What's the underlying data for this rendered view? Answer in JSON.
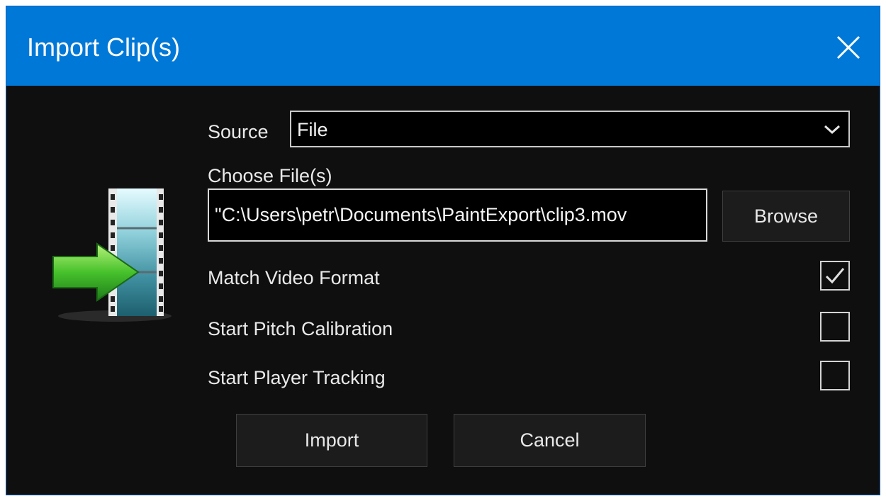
{
  "window": {
    "title": "Import Clip(s)",
    "close_icon": "close-icon"
  },
  "form": {
    "source_label": "Source",
    "source_value": "File",
    "choose_files_label": "Choose File(s)",
    "file_path_value": "C:\\Users\\petr\\Documents\\PaintExport\\clip3.mov\"",
    "browse_label": "Browse",
    "options": [
      {
        "label": "Match Video Format",
        "checked": true
      },
      {
        "label": "Start Pitch Calibration",
        "checked": false
      },
      {
        "label": "Start Player Tracking",
        "checked": false
      }
    ]
  },
  "actions": {
    "import_label": "Import",
    "cancel_label": "Cancel"
  },
  "colors": {
    "titlebar": "#0078d7",
    "background": "#0f0f0f",
    "arrow": "#3fbf2a",
    "film": "#3f8fa0"
  }
}
